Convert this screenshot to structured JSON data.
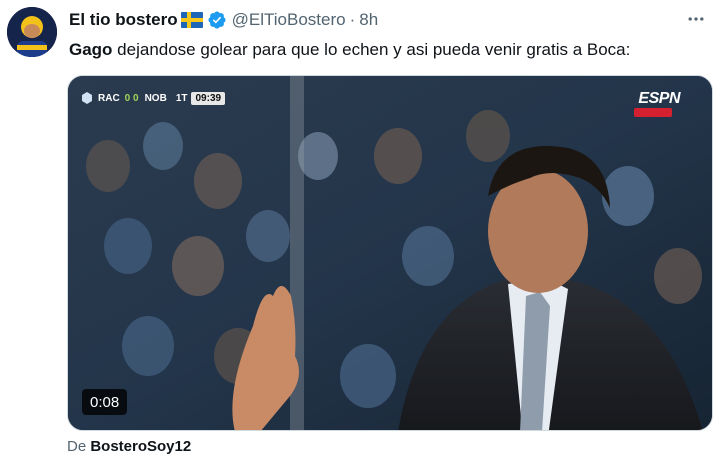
{
  "tweet": {
    "author": {
      "display_name": "El tio bostero",
      "flag_icon": "sweden-flag-icon",
      "verified_icon": "verified-badge-icon",
      "handle": "@ElTioBostero",
      "separator": "·",
      "time": "8h"
    },
    "more_icon": "more-options-icon",
    "text_bold": "Gago",
    "text_rest": " dejandose golear para que lo echen y asi pueda venir gratis a Boca:"
  },
  "video": {
    "scoreboard": {
      "home_team": "RAC",
      "home_score": "0 0",
      "away_team": "NOB",
      "period": "1T",
      "clock": "09:39"
    },
    "network_logo": "ESPN",
    "duration": "0:08"
  },
  "attribution": {
    "prefix": "De ",
    "source": "BosteroSoy12"
  },
  "colors": {
    "text_primary": "#0f1419",
    "text_secondary": "#536471",
    "verified_blue": "#1d9bf0",
    "espn_red": "#d5202f"
  }
}
